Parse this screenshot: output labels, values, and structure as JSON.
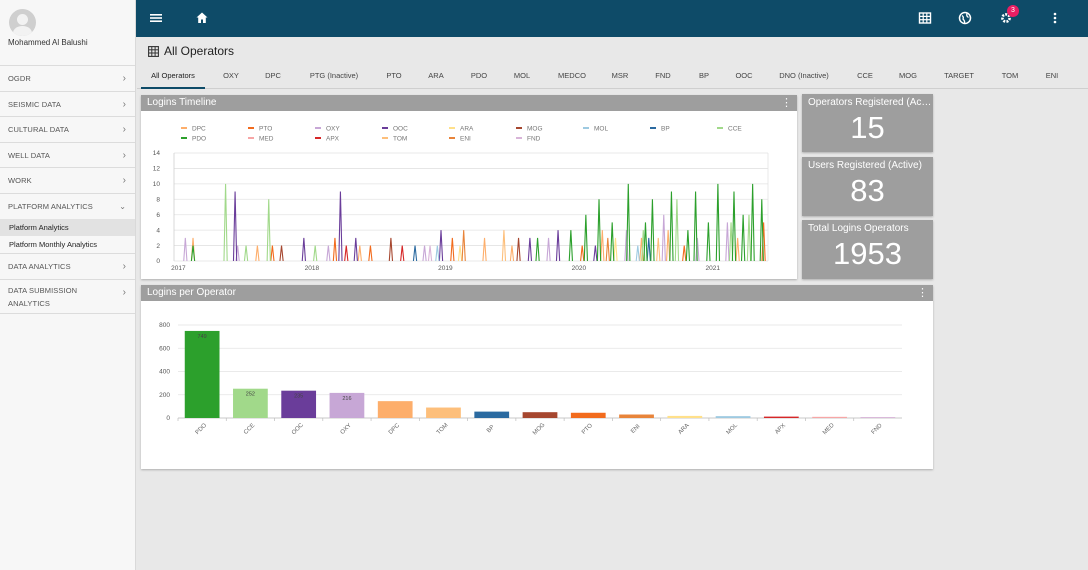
{
  "user": {
    "name": "Mohammed Al Balushi"
  },
  "sidebar": {
    "items": [
      {
        "label": "OGDR"
      },
      {
        "label": "SEISMIC DATA"
      },
      {
        "label": "CULTURAL DATA"
      },
      {
        "label": "WELL DATA"
      },
      {
        "label": "WORK"
      },
      {
        "label": "PLATFORM ANALYTICS"
      },
      {
        "label": "DATA ANALYTICS"
      },
      {
        "label": "DATA SUBMISSION ANALYTICS"
      }
    ],
    "subitems": [
      {
        "label": "Platform Analytics"
      },
      {
        "label": "Platform Monthly Analytics"
      }
    ]
  },
  "topbar": {
    "badge_count": "3",
    "icons": [
      "menu-icon",
      "home-icon",
      "grid-icon",
      "globe-icon",
      "gear-icon",
      "more-vert-icon"
    ]
  },
  "page": {
    "title": "All Operators"
  },
  "tabs": [
    "All Operators",
    "OXY",
    "DPC",
    "PTG (Inactive)",
    "PTO",
    "ARA",
    "PDO",
    "MOL",
    "MEDCO",
    "MSR",
    "FND",
    "BP",
    "OOC",
    "DNO (Inactive)",
    "CCE",
    "MOG",
    "TARGET",
    "TOM",
    "ENI"
  ],
  "stats": [
    {
      "label": "Operators Registered (Active)",
      "value": "15"
    },
    {
      "label": "Users Registered (Active)",
      "value": "83"
    },
    {
      "label": "Total Logins Operators",
      "value": "1953"
    }
  ],
  "colors": {
    "DPC": "#fdae6b",
    "PTO": "#f26b1d",
    "OXY": "#c7a7d6",
    "OOC": "#6a3d9a",
    "ARA": "#ffe08a",
    "MOG": "#a6472f",
    "MOL": "#9ecae1",
    "BP": "#2b6aa0",
    "CCE": "#a1d98a",
    "PDO": "#2ca02c",
    "MED": "#f7a6a6",
    "APX": "#d62728",
    "TOM": "#fdbf7b",
    "ENI": "#e8843a",
    "FND": "#d8b4d8"
  },
  "chart_data": [
    {
      "type": "line",
      "title": "Logins Timeline",
      "legend": [
        "DPC",
        "PTO",
        "OXY",
        "OOC",
        "ARA",
        "MOG",
        "MOL",
        "BP",
        "CCE",
        "PDO",
        "MED",
        "APX",
        "TOM",
        "ENI",
        "FND"
      ],
      "x_ticks": [
        "2017",
        "2018",
        "2019",
        "2020",
        "2021"
      ],
      "ylim": [
        0,
        14
      ],
      "y_ticks": [
        0,
        2,
        4,
        6,
        8,
        10,
        12,
        14
      ],
      "grid": true,
      "legend_position": "top",
      "series": [
        {
          "name": "DPC",
          "points": [
            [
              "2017-02-10",
              3
            ],
            [
              "2017-08-05",
              2
            ],
            [
              "2018-05-12",
              2
            ],
            [
              "2019-04-18",
              3
            ],
            [
              "2019-07-02",
              2
            ],
            [
              "2020-03-05",
              4
            ],
            [
              "2020-06-20",
              3
            ],
            [
              "2020-09-01",
              4
            ],
            [
              "2021-03-10",
              3
            ]
          ]
        },
        {
          "name": "PTO",
          "points": [
            [
              "2017-09-15",
              2
            ],
            [
              "2018-03-05",
              3
            ],
            [
              "2018-06-10",
              2
            ],
            [
              "2019-01-20",
              3
            ],
            [
              "2020-01-10",
              2
            ],
            [
              "2020-10-15",
              2
            ],
            [
              "2021-05-20",
              5
            ]
          ]
        },
        {
          "name": "OXY",
          "points": [
            [
              "2017-01-20",
              3
            ],
            [
              "2017-06-12",
              2
            ],
            [
              "2018-02-15",
              2
            ],
            [
              "2018-11-05",
              2
            ],
            [
              "2019-10-10",
              3
            ],
            [
              "2020-05-10",
              4
            ],
            [
              "2020-08-20",
              6
            ],
            [
              "2020-11-20",
              3
            ],
            [
              "2021-02-10",
              5
            ]
          ]
        },
        {
          "name": "OOC",
          "points": [
            [
              "2017-06-05",
              9
            ],
            [
              "2017-12-10",
              3
            ],
            [
              "2018-03-20",
              9
            ],
            [
              "2018-05-01",
              3
            ],
            [
              "2018-12-20",
              4
            ],
            [
              "2019-08-20",
              3
            ],
            [
              "2019-11-05",
              4
            ],
            [
              "2020-02-15",
              2
            ]
          ]
        },
        {
          "name": "ARA",
          "points": [
            [
              "2019-02-10",
              2
            ],
            [
              "2020-04-10",
              3
            ]
          ]
        },
        {
          "name": "MOG",
          "points": [
            [
              "2017-10-10",
              2
            ],
            [
              "2018-08-05",
              3
            ],
            [
              "2019-07-20",
              3
            ]
          ]
        },
        {
          "name": "MOL",
          "points": [
            [
              "2018-12-10",
              2
            ],
            [
              "2020-06-10",
              2
            ]
          ]
        },
        {
          "name": "BP",
          "points": [
            [
              "2018-10-10",
              2
            ],
            [
              "2020-07-10",
              3
            ]
          ]
        },
        {
          "name": "CCE",
          "points": [
            [
              "2017-05-10",
              10
            ],
            [
              "2017-07-05",
              2
            ],
            [
              "2017-09-05",
              8
            ],
            [
              "2018-01-10",
              2
            ],
            [
              "2020-06-25",
              4
            ],
            [
              "2020-09-25",
              8
            ],
            [
              "2021-02-20",
              5
            ],
            [
              "2021-04-10",
              6
            ]
          ]
        },
        {
          "name": "PDO",
          "points": [
            [
              "2017-02-10",
              2
            ],
            [
              "2019-09-10",
              3
            ],
            [
              "2019-12-10",
              4
            ],
            [
              "2020-01-20",
              6
            ],
            [
              "2020-02-25",
              8
            ],
            [
              "2020-04-01",
              5
            ],
            [
              "2020-05-15",
              10
            ],
            [
              "2020-07-01",
              5
            ],
            [
              "2020-07-20",
              8
            ],
            [
              "2020-09-10",
              9
            ],
            [
              "2020-10-25",
              4
            ],
            [
              "2020-11-15",
              9
            ],
            [
              "2020-12-20",
              5
            ],
            [
              "2021-01-15",
              10
            ],
            [
              "2021-02-28",
              9
            ],
            [
              "2021-03-25",
              6
            ],
            [
              "2021-04-20",
              10
            ],
            [
              "2021-05-15",
              8
            ]
          ]
        },
        {
          "name": "APX",
          "points": [
            [
              "2018-04-05",
              2
            ],
            [
              "2018-09-05",
              2
            ]
          ]
        },
        {
          "name": "TOM",
          "points": [
            [
              "2019-06-10",
              4
            ],
            [
              "2020-08-05",
              3
            ]
          ]
        },
        {
          "name": "ENI",
          "points": [
            [
              "2019-02-20",
              4
            ],
            [
              "2020-03-20",
              3
            ]
          ]
        },
        {
          "name": "FND",
          "points": [
            [
              "2018-11-20",
              2
            ]
          ]
        }
      ]
    },
    {
      "type": "bar",
      "title": "Logins per Operator",
      "categories": [
        "PDO",
        "CCE",
        "OOC",
        "OXY",
        "DPC",
        "TOM",
        "BP",
        "MOG",
        "PTO",
        "ENI",
        "ARA",
        "MOL",
        "APX",
        "MED",
        "FND"
      ],
      "values": [
        749,
        252,
        235,
        216,
        145,
        90,
        55,
        50,
        45,
        30,
        18,
        16,
        12,
        10,
        8
      ],
      "data_labels": [
        "749",
        "252",
        "235",
        "216",
        "",
        "",
        "",
        "",
        "",
        "",
        "",
        "",
        "",
        "",
        ""
      ],
      "ylim": [
        0,
        800
      ],
      "y_ticks": [
        0,
        200,
        400,
        600,
        800
      ],
      "grid": true
    }
  ]
}
